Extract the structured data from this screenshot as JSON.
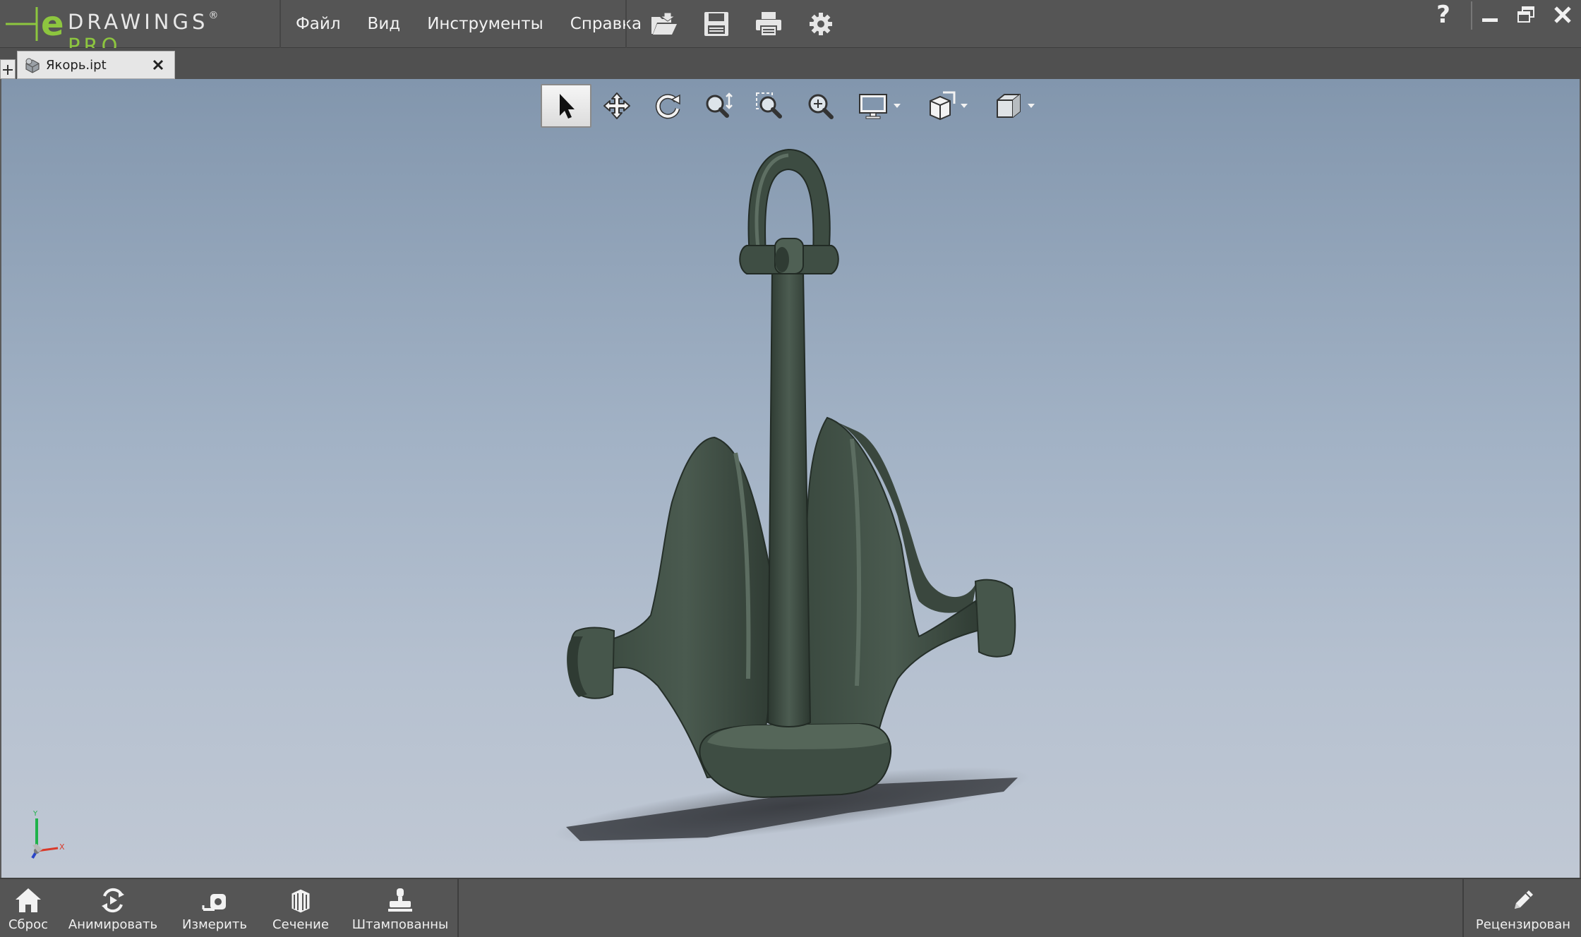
{
  "app": {
    "brand_main": "DRAWINGS",
    "brand_pro": "PRO",
    "brand_reg": "®"
  },
  "menu": [
    "Файл",
    "Вид",
    "Инструменты",
    "Справка"
  ],
  "file_tools": [
    "open-icon",
    "save-icon",
    "print-icon",
    "gear-icon"
  ],
  "window": {
    "help": "?"
  },
  "tab": {
    "label": "Якорь.ipt"
  },
  "view_toolbar": [
    "select-icon",
    "pan-icon",
    "rotate-icon",
    "zoom-icon",
    "zoom-window-icon",
    "zoom-fit-icon",
    "display-style-icon",
    "section-view-icon",
    "standard-views-icon"
  ],
  "triad": {
    "y": "Y",
    "x": "X"
  },
  "bottom": {
    "reset": "Сброс",
    "animate": "Анимировать",
    "measure": "Измерить",
    "section": "Сечение",
    "stamp": "Штампованны",
    "review": "Рецензирован"
  },
  "colors": {
    "accent": "#8dc63f",
    "model": "#3c4a41",
    "chrome": "#555555"
  }
}
